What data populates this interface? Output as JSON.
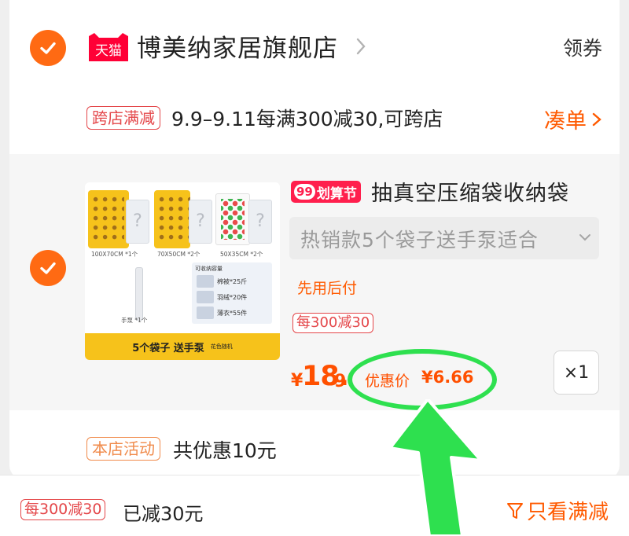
{
  "shop": {
    "platform_logo_text": "天猫",
    "name": "博美纳家居旗舰店",
    "coupon_label": "领券"
  },
  "promo": {
    "tag": "跨店满减",
    "text": "9.9–9.11每满300减30,可跨店",
    "action_label": "凑单"
  },
  "item": {
    "thumbnail": {
      "captions": [
        "100X70CM *1个",
        "70X50CM *2个",
        "50X35CM *2个",
        "手泵 *1个"
      ],
      "capacity_title": "可收纳容量",
      "capacity_lines": [
        "棉被*25斤",
        "羽绒*20件",
        "薄衣*55件"
      ],
      "banner_main": "5个袋子 送手泵",
      "banner_sub": "花色随机",
      "question_mark": "?"
    },
    "festival_badge_num": "99",
    "festival_badge_text": "划算节",
    "title": "抽真空压缩袋收纳袋",
    "sku": "热销款5个袋子送手泵适合",
    "pay_later": "先用后付",
    "deal_tag": "每300减30",
    "price_symbol": "¥",
    "price_main": "18.",
    "price_decimal": "9",
    "discount_label": "优惠价",
    "discount_value": "¥6.66",
    "quantity": "×1"
  },
  "activity": {
    "tag": "本店活动",
    "text": "共优惠10元"
  },
  "bottom_bar": {
    "deal_tag": "每300减30",
    "saved_text": "已减30元",
    "filter_label": "只看满减"
  },
  "colors": {
    "accent_orange": "#ff6a13",
    "price_orange": "#ff5000",
    "tag_red": "#e4474a",
    "tmall_red": "#ff0036",
    "annotation_green": "#2ee04f"
  },
  "icons": {
    "check": "check-icon",
    "tmall": "tmall-cat-icon",
    "chevron_right": "chevron-right-icon",
    "chevron_down": "chevron-down-icon",
    "filter": "filter-funnel-icon"
  }
}
